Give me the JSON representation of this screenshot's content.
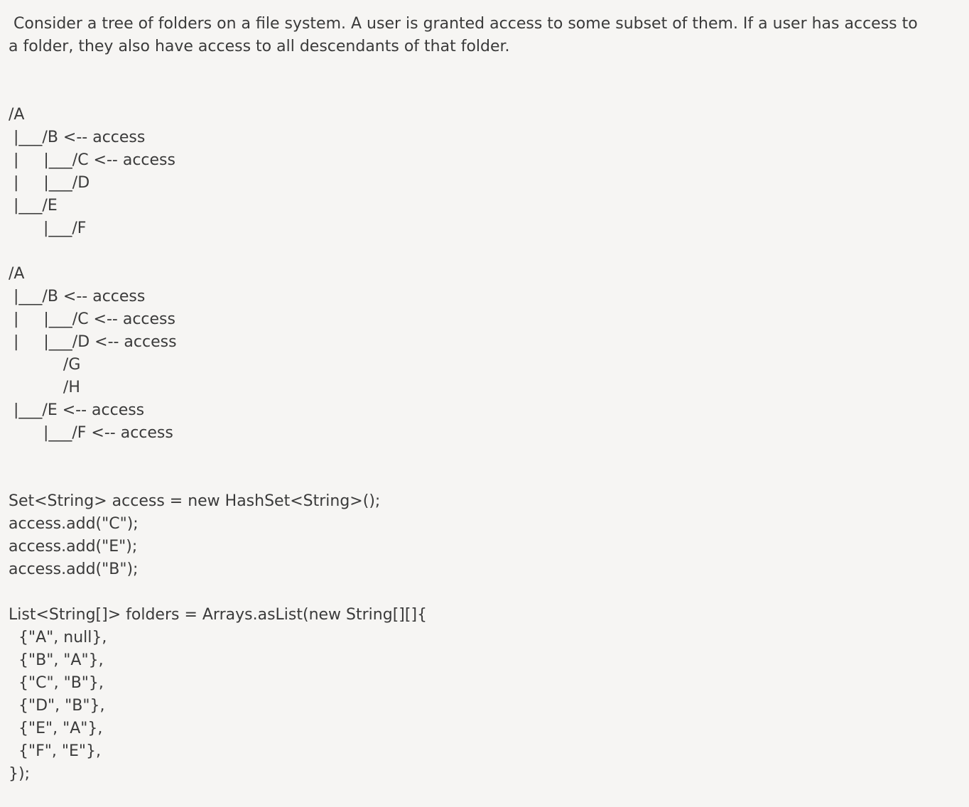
{
  "intro": {
    "lines": [
      " Consider a tree of folders on a file system. A user is granted access to some subset of them. If a user has access to",
      "a folder, they also have access to all descendants of that folder."
    ]
  },
  "tree_example_1": {
    "lines": [
      "/A",
      " |___/B <-- access",
      " |     |___/C <-- access",
      " |     |___/D",
      " |___/E",
      "       |___/F"
    ]
  },
  "tree_example_2": {
    "lines": [
      "/A",
      " |___/B <-- access",
      " |     |___/C <-- access",
      " |     |___/D <-- access",
      "           /G",
      "           /H",
      " |___/E <-- access",
      "       |___/F <-- access"
    ]
  },
  "code_access": {
    "lines": [
      "Set<String> access = new HashSet<String>();",
      "access.add(\"C\");",
      "access.add(\"E\");",
      "access.add(\"B\");"
    ]
  },
  "code_folders": {
    "lines": [
      "List<String[]> folders = Arrays.asList(new String[][]{",
      "  {\"A\", null},",
      "  {\"B\", \"A\"},",
      "  {\"C\", \"B\"},",
      "  {\"D\", \"B\"},",
      "  {\"E\", \"A\"},",
      "  {\"F\", \"E\"},",
      "});"
    ]
  }
}
